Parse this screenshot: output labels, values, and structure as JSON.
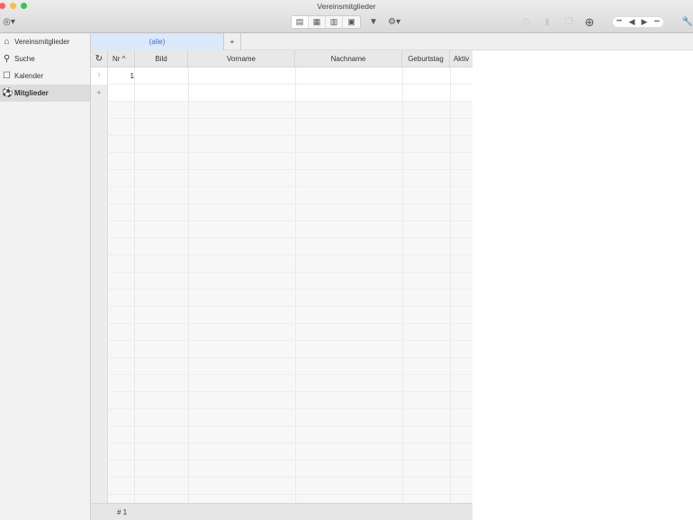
{
  "window": {
    "title": "Vereinsmitglieder"
  },
  "sidebar": {
    "items": [
      {
        "label": "Vereinsmitglieder",
        "icon": "home-icon"
      },
      {
        "label": "Suche",
        "icon": "search-icon"
      },
      {
        "label": "Kalender",
        "icon": "calendar-icon"
      },
      {
        "label": "Mitglieder",
        "icon": "members-icon"
      }
    ]
  },
  "tabs": {
    "active": "(alle)",
    "add": "+"
  },
  "table": {
    "columns": [
      "Nr ^",
      "Bild",
      "Vorname",
      "Nachname",
      "Geburtstag",
      "Aktiv"
    ],
    "rows": [
      {
        "index": "1",
        "nr": "1"
      }
    ],
    "add_row": "+",
    "footer_count": "# 1"
  }
}
